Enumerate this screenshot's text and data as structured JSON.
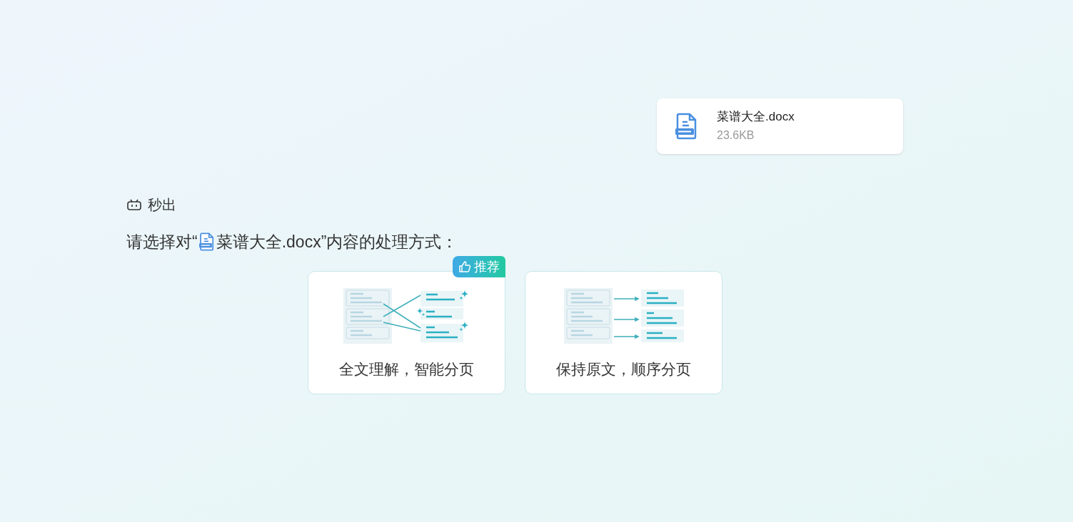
{
  "file_card": {
    "name": "菜谱大全.docx",
    "size": "23.6KB"
  },
  "status": {
    "label": "秒出"
  },
  "prompt": {
    "prefix": "请选择对“",
    "file_name": "菜谱大全.docx",
    "suffix": "”内容的处理方式："
  },
  "options": [
    {
      "kind": "smart",
      "label": "全文理解，智能分页",
      "recommended": true,
      "badge": "推荐"
    },
    {
      "kind": "sequential",
      "label": "保持原文，顺序分页",
      "recommended": false
    }
  ]
}
